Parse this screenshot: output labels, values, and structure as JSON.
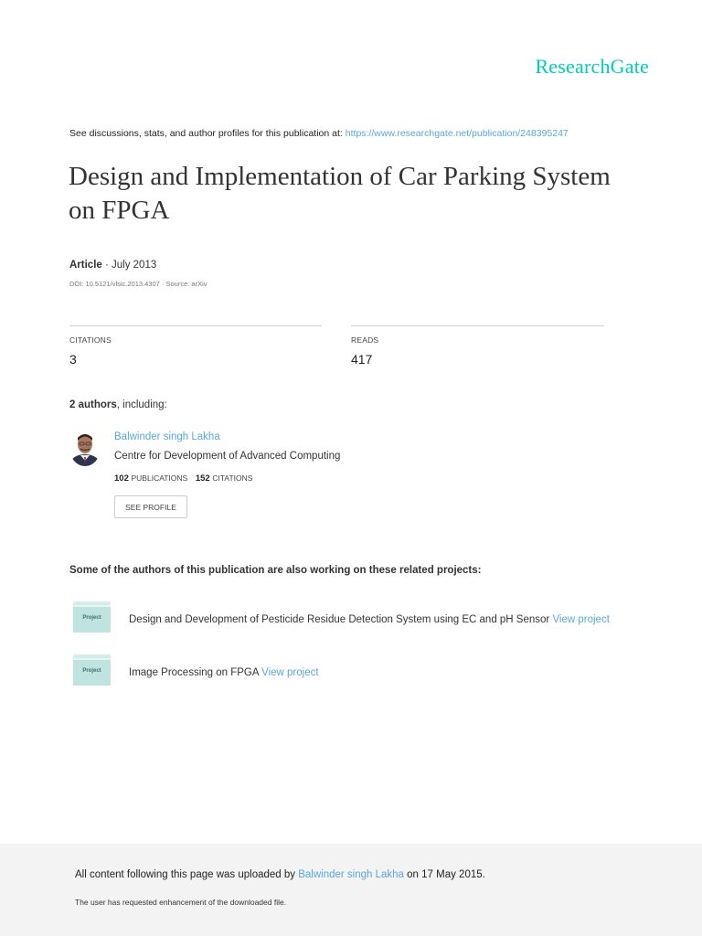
{
  "brand": {
    "name": "ResearchGate",
    "color": "#00ccbb"
  },
  "source": {
    "prefix": "See discussions, stats, and author profiles for this publication at:",
    "url": "https://www.researchgate.net/publication/248395247"
  },
  "publication": {
    "title": "Design and Implementation of Car Parking System on FPGA",
    "type": "Article",
    "date": " · July 2013",
    "doi_line": "DOI: 10.5121/vlsic.2013.4307 · Source: arXiv"
  },
  "stats": {
    "citations_label": "CITATIONS",
    "citations_value": "3",
    "reads_label": "READS",
    "reads_value": "417"
  },
  "authors": {
    "count_text": "2 authors",
    "suffix": ", including:",
    "list": [
      {
        "name": "Balwinder singh Lakha",
        "institution": "Centre for Development of Advanced Computing",
        "publications_count": "102",
        "publications_label": "PUBLICATIONS",
        "citations_count": "152",
        "citations_label": "CITATIONS",
        "profile_button": "SEE PROFILE"
      }
    ]
  },
  "projects": {
    "heading": "Some of the authors of this publication are also working on these related projects:",
    "icon_label": "Project",
    "link_label": "View project",
    "items": [
      {
        "title": "Design and Development of Pesticide Residue Detection System using EC and pH Sensor"
      },
      {
        "title": "Image Processing on FPGA"
      }
    ]
  },
  "footer": {
    "upload_prefix": "All content following this page was uploaded by",
    "uploader": "Balwinder singh Lakha",
    "upload_suffix": " on 17 May 2015.",
    "note": "The user has requested enhancement of the downloaded file."
  },
  "colors": {
    "link": "#5aa7d8",
    "footer_bg": "#f3f3f3",
    "project_icon": "#bfe4df"
  }
}
